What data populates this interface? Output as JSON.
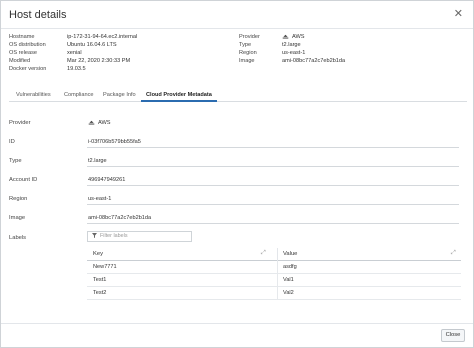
{
  "dialog": {
    "title": "Host details",
    "close_symbol": "✕"
  },
  "summary": {
    "left": [
      {
        "key": "Hostname",
        "value": "ip-172-31-94-64.ec2.internal"
      },
      {
        "key": "OS distribution",
        "value": "Ubuntu 16.04.6 LTS"
      },
      {
        "key": "OS release",
        "value": "xenial"
      },
      {
        "key": "Modified",
        "value": "Mar 22, 2020 2:30:33 PM"
      },
      {
        "key": "Docker version",
        "value": "19.03.5"
      }
    ],
    "right": [
      {
        "key": "Provider",
        "value": "AWS"
      },
      {
        "key": "Type",
        "value": "t2.large"
      },
      {
        "key": "Region",
        "value": "us-east-1"
      },
      {
        "key": "Image",
        "value": "ami-08bc77a2c7eb2b1da"
      }
    ]
  },
  "tabs": [
    {
      "label": "Vulnerabilities",
      "active": false
    },
    {
      "label": "Compliance",
      "active": false
    },
    {
      "label": "Package Info",
      "active": false
    },
    {
      "label": "Cloud Provider Metadata",
      "active": true
    }
  ],
  "metadata": {
    "fields": [
      {
        "label": "Provider",
        "value": "AWS"
      },
      {
        "label": "ID",
        "value": "i-03f706b579bb55fa5"
      },
      {
        "label": "Type",
        "value": "t2.large"
      },
      {
        "label": "Account ID",
        "value": "496947949261"
      },
      {
        "label": "Region",
        "value": "us-east-1"
      },
      {
        "label": "Image",
        "value": "ami-08bc77a2c7eb2b1da"
      }
    ],
    "labels_title": "Labels",
    "filter_placeholder": "Filter labels",
    "table": {
      "headers": [
        "Key",
        "Value"
      ],
      "rows": [
        {
          "key": "New7771",
          "value": "asdfg"
        },
        {
          "key": "Test1",
          "value": "Val1"
        },
        {
          "key": "Test2",
          "value": "Val2"
        }
      ]
    }
  },
  "footer": {
    "close_label": "Close"
  },
  "icons": {
    "provider": "aws-icon",
    "filter": "filter-icon",
    "sort": "sort-icon"
  }
}
